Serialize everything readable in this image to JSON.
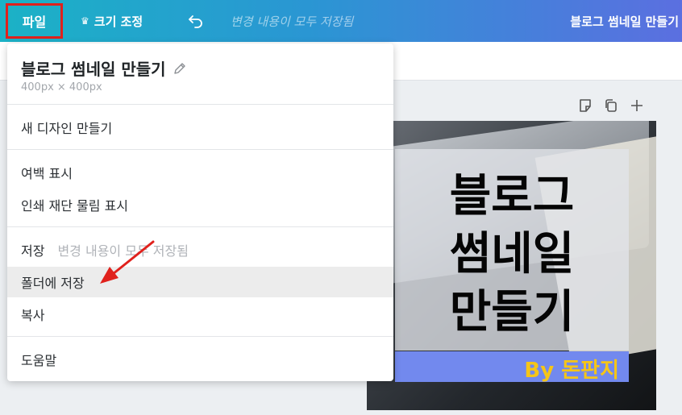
{
  "toolbar": {
    "file_label": "파일",
    "resize_label": "크기 조정",
    "save_status": "변경 내용이 모두 저장됨",
    "doc_title": "블로그 썸네일 만들기"
  },
  "menu": {
    "title": "블로그 썸네일 만들기",
    "size": "400px × 400px",
    "items": {
      "new_design": "새 디자인 만들기",
      "show_margins": "여백 표시",
      "show_bleed": "인쇄 재단 물림 표시",
      "save": "저장",
      "save_status": "변경 내용이 모두 저장됨",
      "save_to_folder": "폴더에 저장",
      "copy": "복사",
      "help": "도움말"
    }
  },
  "canvas": {
    "title_lines": [
      "블로그",
      "썸네일",
      "만들기"
    ],
    "byline": "By 돈판지"
  },
  "icons": {
    "crown": "crown-icon",
    "undo": "undo-icon",
    "pencil": "pencil-icon",
    "note": "note-icon",
    "copy_page": "duplicate-icon",
    "add_page": "plus-icon"
  },
  "colors": {
    "highlight_box": "#e0211c",
    "annotation_arrow": "#e0211c",
    "byline_bg": "#7289ee",
    "byline_text": "#f5c518"
  }
}
